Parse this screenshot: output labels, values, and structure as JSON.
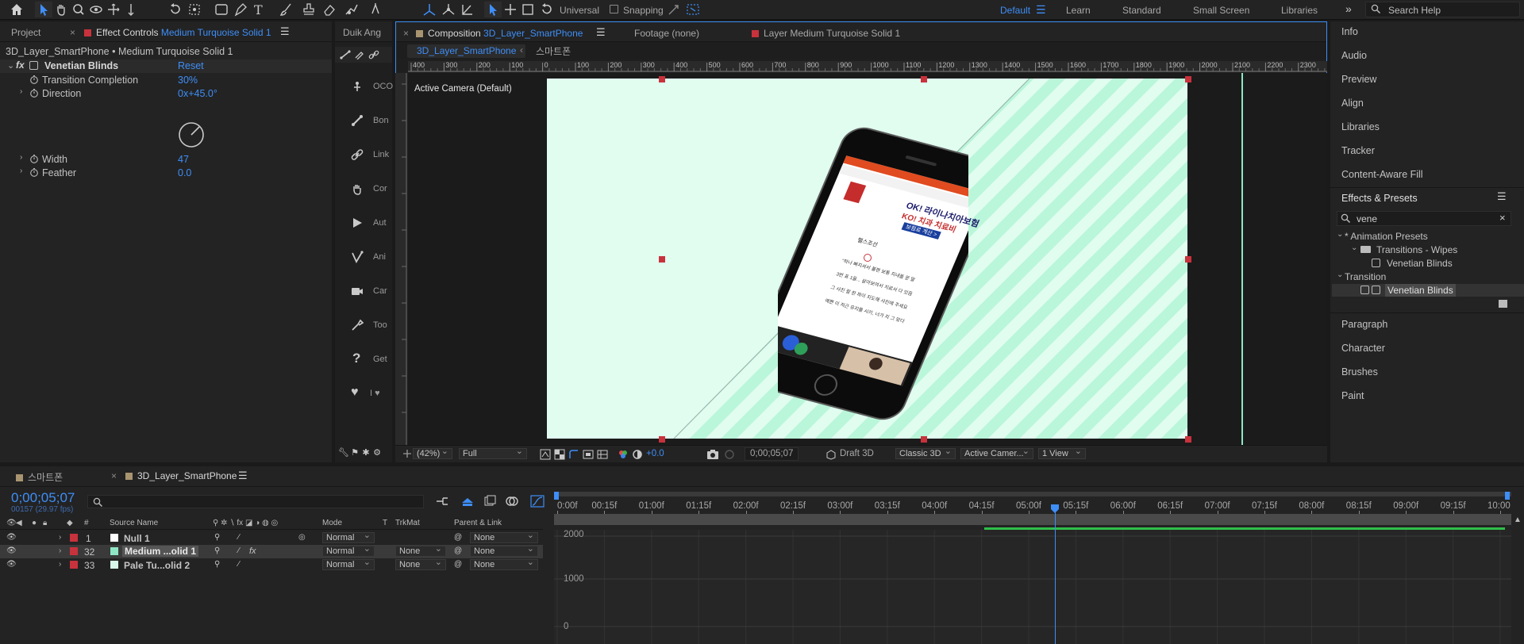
{
  "toolbar": {
    "axis_mode": "Universal",
    "snapping_label": "Snapping",
    "workspaces": [
      "Default",
      "Learn",
      "Standard",
      "Small Screen",
      "Libraries"
    ],
    "active_workspace": "Default",
    "search_placeholder": "Search Help"
  },
  "left_panel": {
    "tab_project": "Project",
    "tab_effect_controls_prefix": "Effect Controls",
    "tab_effect_controls_layer": "Medium Turquoise Solid 1",
    "subtitle": "3D_Layer_SmartPhone • Medium Turquoise Solid 1",
    "effect_name": "Venetian Blinds",
    "reset_label": "Reset",
    "properties": [
      {
        "label": "Transition Completion",
        "value": "30%"
      },
      {
        "label": "Direction",
        "value": "0x+45.0°"
      },
      {
        "label": "Width",
        "value": "47"
      },
      {
        "label": "Feather",
        "value": "0.0"
      }
    ]
  },
  "duik_panel": {
    "tab": "Duik Ang",
    "items": [
      "OCO",
      "Bon",
      "Link",
      "Cor",
      "Aut",
      "Ani",
      "Car",
      "Too",
      "Get",
      "I ♥"
    ]
  },
  "viewer": {
    "tab_comp_prefix": "Composition",
    "tab_comp_name": "3D_Layer_SmartPhone",
    "tab_footage": "Footage (none)",
    "tab_layer_prefix": "Layer",
    "tab_layer_name": "Medium Turquoise Solid 1",
    "subtab_active": "3D_Layer_SmartPhone",
    "subtab_other": "스마트폰",
    "camera_label": "Active Camera (Default)",
    "ruler_labels": [
      "400",
      "300",
      "200",
      "100",
      "0",
      "100",
      "200",
      "300",
      "400",
      "500",
      "600",
      "700",
      "800",
      "900",
      "1000",
      "1100",
      "1200",
      "1300",
      "1400",
      "1500",
      "1600",
      "1700",
      "1800",
      "1900",
      "2000",
      "2100",
      "2200",
      "2300"
    ],
    "bottom": {
      "zoom": "(42%)",
      "resolution": "Full",
      "exposure": "+0.0",
      "timecode": "0;00;05;07",
      "draft": "Draft 3D",
      "renderer": "Classic 3D",
      "camera": "Active Camer...",
      "views": "1 View"
    },
    "colors": {
      "background_solid": "#e0fdf0",
      "stripes": "#baf6d9"
    }
  },
  "phone_screen": {
    "headline": "OK! 라이나치아보험",
    "headline2": "KO! 치과 치료비",
    "button": "보험료 계산 >",
    "user": "헬스조선",
    "lines": [
      "\"하나 빠지셔서 불편 보통 지내돌 문 말",
      "3번 표 1을... 살아보여서 치료서 다 있음",
      "그 사진 잘 한 파이 지도해 사진에 주세요",
      "예쁜 이 저근 유지를 시키, 너가 지 그 맞다"
    ]
  },
  "right_panel": {
    "items_top": [
      "Info",
      "Audio",
      "Preview",
      "Align",
      "Libraries",
      "Tracker",
      "Content-Aware Fill"
    ],
    "effects_title": "Effects & Presets",
    "search_value": "vene",
    "tree": [
      {
        "label": "* Animation Presets",
        "level": 0
      },
      {
        "label": "Transitions - Wipes",
        "level": 1
      },
      {
        "label": "Venetian Blinds",
        "level": 2
      },
      {
        "label": "Transition",
        "level": 0
      },
      {
        "label": "Venetian Blinds",
        "level": 2,
        "selected": true
      }
    ],
    "items_bottom": [
      "Paragraph",
      "Character",
      "Brushes",
      "Paint"
    ]
  },
  "timeline": {
    "tab_other": "스마트폰",
    "tab_active": "3D_Layer_SmartPhone",
    "timecode": "0;00;05;07",
    "frame_info": "00157 (29.97 fps)",
    "search_placeholder": "",
    "columns": {
      "source": "Source Name",
      "mode": "Mode",
      "t": "T",
      "trkmat": "TrkMat",
      "parent": "Parent & Link"
    },
    "layers": [
      {
        "num": "1",
        "name": "Null 1",
        "color": "#ffffff",
        "mode": "Normal",
        "trkmat": "",
        "parent": "None"
      },
      {
        "num": "32",
        "name": "Medium ...olid 1",
        "color": "#8fe6c4",
        "mode": "Normal",
        "trkmat": "None",
        "parent": "None",
        "selected": true
      },
      {
        "num": "33",
        "name": "Pale Tu...olid 2",
        "color": "#d6f7ea",
        "mode": "Normal",
        "trkmat": "None",
        "parent": "None"
      }
    ],
    "ruler": [
      "0:00f",
      "00:15f",
      "01:00f",
      "01:15f",
      "02:00f",
      "02:15f",
      "03:00f",
      "03:15f",
      "04:00f",
      "04:15f",
      "05:00f",
      "05:15f",
      "06:00f",
      "06:15f",
      "07:00f",
      "07:15f",
      "08:00f",
      "08:15f",
      "09:00f",
      "09:15f",
      "10:00"
    ],
    "graph_labels": [
      "2000",
      "1000",
      "0"
    ]
  }
}
